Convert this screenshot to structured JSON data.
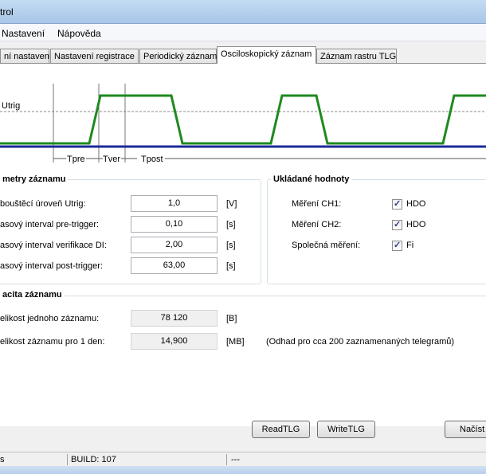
{
  "window": {
    "title_fragment": "trol"
  },
  "menu": {
    "items": [
      "Nastavení",
      "Nápověda"
    ]
  },
  "tabs": [
    "ní nastavení",
    "Nastavení registrace",
    "Periodický záznam",
    "Osciloskopický záznam",
    "Záznam rastru TLG"
  ],
  "active_tab": 3,
  "diagram": {
    "utrig_label": "Utrig",
    "tpre_label": "Tpre",
    "tver_label": "Tver",
    "tpost_label": "Tpost",
    "signal_color": "#1e8a1e",
    "baseline_color": "#1a2a9a"
  },
  "params": {
    "title": "metry záznamu",
    "rows": [
      {
        "label": "bouštěcí úroveň Utrig:",
        "value": "1,0",
        "unit": "[V]"
      },
      {
        "label": "asový interval pre-trigger:",
        "value": "0,10",
        "unit": "[s]"
      },
      {
        "label": "asový interval verifikace DI:",
        "value": "2,00",
        "unit": "[s]"
      },
      {
        "label": "asový interval post-trigger:",
        "value": "63,00",
        "unit": "[s]"
      }
    ]
  },
  "saved": {
    "title": "Ukládané hodnoty",
    "rows": [
      {
        "label": "Měření CH1:",
        "check": "HDO"
      },
      {
        "label": "Měření CH2:",
        "check": "HDO"
      },
      {
        "label": "Společná měření:",
        "check": "Fi"
      }
    ]
  },
  "capacity": {
    "title": "acita záznamu",
    "rows": [
      {
        "label": "elikost jednoho záznamu:",
        "value": "78 120",
        "unit": "[B]"
      },
      {
        "label": "elikost záznamu pro 1 den:",
        "value": "14,900",
        "unit": "[MB]"
      }
    ],
    "note": "(Odhad pro cca 200 zaznamenaných telegramů)"
  },
  "buttons": {
    "read": "ReadTLG",
    "write": "WriteTLG",
    "load": "Načíst"
  },
  "status": {
    "left": "s",
    "build": "BUILD: 107",
    "right": "---"
  }
}
